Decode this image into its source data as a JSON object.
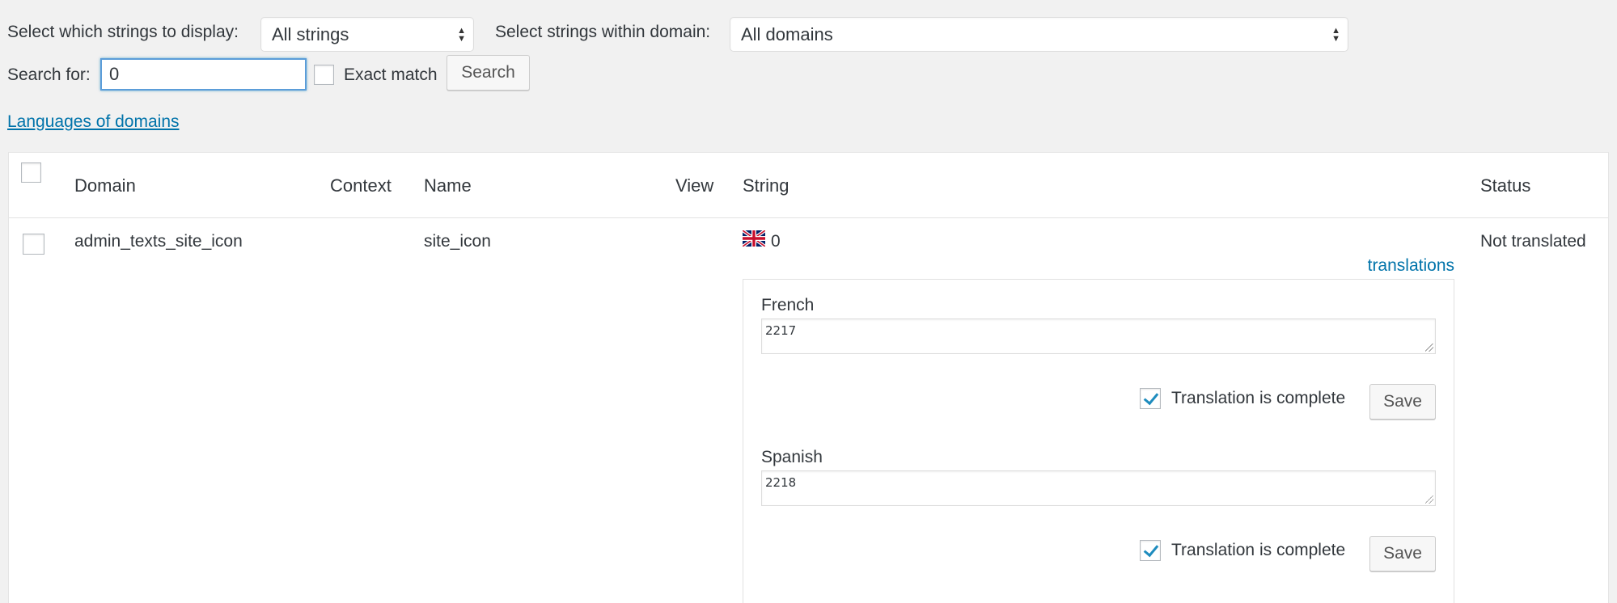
{
  "filters": {
    "display_label": "Select which strings to display:",
    "display_value": "All strings",
    "domain_label": "Select strings within domain:",
    "domain_value": "All domains",
    "search_label": "Search for:",
    "search_value": "0",
    "exact_match_label": "Exact match",
    "exact_match_checked": false,
    "search_button": "Search"
  },
  "languages_link": "Languages of domains",
  "table": {
    "columns": [
      "Domain",
      "Context",
      "Name",
      "View",
      "String",
      "Status"
    ],
    "rows": [
      {
        "domain": "admin_texts_site_icon",
        "context": "",
        "name": "site_icon",
        "view": "",
        "string_flag": "uk-flag-icon",
        "string": "0",
        "status": "Not translated",
        "translations_link": "translations",
        "translations": [
          {
            "language": "French",
            "value": "2217",
            "complete_label": "Translation is complete",
            "complete": true,
            "save_label": "Save"
          },
          {
            "language": "Spanish",
            "value": "2218",
            "complete_label": "Translation is complete",
            "complete": true,
            "save_label": "Save"
          }
        ]
      }
    ]
  },
  "colors": {
    "accent": "#0073aa",
    "focus": "#5b9dd9",
    "check": "#1e8cbe",
    "background": "#f1f1f1"
  }
}
